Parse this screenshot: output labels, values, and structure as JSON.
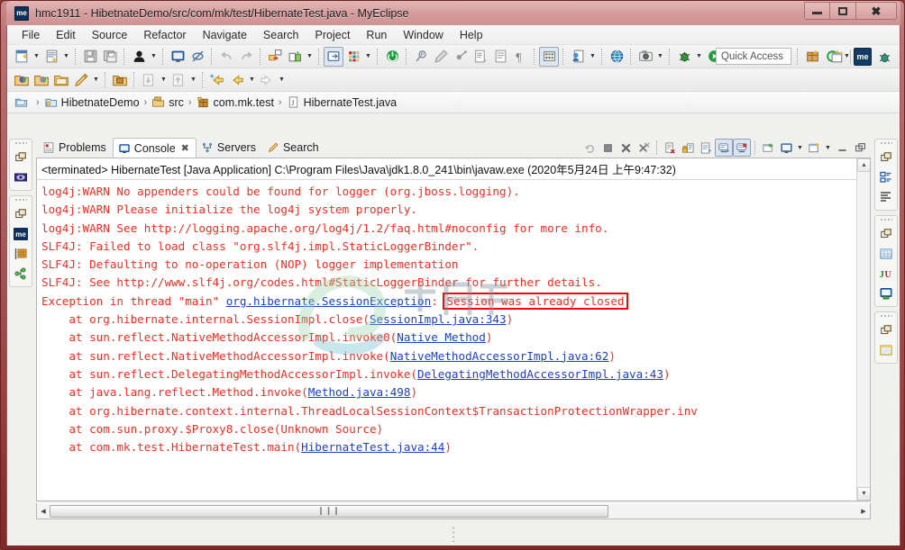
{
  "window": {
    "icon_label": "me",
    "title": "hmc1911 - HibetnateDemo/src/com/mk/test/HibernateTest.java - MyEclipse",
    "minimize_label": "Minimize",
    "maximize_label": "Maximize",
    "close_label": "Close"
  },
  "menubar": {
    "items": [
      {
        "label": "File"
      },
      {
        "label": "Edit"
      },
      {
        "label": "Source"
      },
      {
        "label": "Refactor"
      },
      {
        "label": "Navigate"
      },
      {
        "label": "Search"
      },
      {
        "label": "Project"
      },
      {
        "label": "Run"
      },
      {
        "label": "Window"
      },
      {
        "label": "Help"
      }
    ]
  },
  "toolbar": {
    "quick_access_placeholder": "Quick Access",
    "quick_access_value": "",
    "perspective_me_label": "me",
    "row1_icons": [
      "new-wizard-icon",
      "new-wizard-dropdown-icon",
      "new-java-class-icon",
      "new-java-class-dropdown-icon",
      "save-icon",
      "save-all-icon",
      "user-account-icon",
      "user-account-dropdown-icon",
      "open-console-icon",
      "toggle-breakpoint-icon",
      "undo-icon",
      "redo-icon",
      "import-icon",
      "export-icon",
      "export-dropdown-icon",
      "open-perspective-icon",
      "color-palette-icon",
      "color-palette-dropdown-icon",
      "power-icon",
      "search-tag-icon",
      "pencil-icon",
      "remote-debug-icon",
      "open-type-icon",
      "open-task-icon",
      "pilcrow-icon",
      "grid-icon",
      "new-report-icon",
      "new-report-dropdown-icon",
      "web-browser-icon",
      "snapshot-icon",
      "snapshot-dropdown-icon",
      "debug-icon",
      "debug-dropdown-icon",
      "run-icon",
      "run-dropdown-icon",
      "run-config-icon",
      "run-config-dropdown-icon",
      "run-error-icon",
      "run-error-dropdown-icon",
      "package-icon",
      "refresh-star-icon",
      "refresh-dropdown-icon"
    ],
    "row2_icons": [
      "open-resource-icon",
      "open-folder-icon",
      "open-project-icon",
      "pencil-edit-icon",
      "pencil-dropdown-icon",
      "open-package-icon",
      "previous-annotation-icon",
      "previous-annotation-dropdown-icon",
      "next-annotation-icon",
      "next-annotation-dropdown-icon",
      "back-star-icon",
      "back-icon",
      "back-dropdown-icon",
      "forward-icon",
      "forward-dropdown-icon"
    ]
  },
  "breadcrumb": {
    "items": [
      {
        "label": "",
        "icon": "workspace-icon"
      },
      {
        "label": "HibetnateDemo",
        "icon": "java-project-icon"
      },
      {
        "label": "src",
        "icon": "source-folder-icon"
      },
      {
        "label": "com.mk.test",
        "icon": "package-icon"
      },
      {
        "label": "HibernateTest.java",
        "icon": "java-file-icon"
      }
    ],
    "separator": "›"
  },
  "views": {
    "tabs": [
      {
        "label": "Problems",
        "icon": "problems-icon",
        "active": false,
        "closable": false
      },
      {
        "label": "Console",
        "icon": "console-icon",
        "active": true,
        "closable": true
      },
      {
        "label": "Servers",
        "icon": "servers-icon",
        "active": false,
        "closable": false
      },
      {
        "label": "Search",
        "icon": "search-icon",
        "active": false,
        "closable": false
      }
    ],
    "close_glyph": "✖"
  },
  "console_toolbar": {
    "buttons": [
      {
        "name": "relaunch-icon",
        "pressed": false
      },
      {
        "name": "terminate-icon",
        "pressed": false
      },
      {
        "name": "remove-launch-icon",
        "pressed": false
      },
      {
        "name": "remove-all-terminated-icon",
        "pressed": false
      },
      {
        "name": "clear-console-icon",
        "pressed": false
      },
      {
        "name": "scroll-lock-icon",
        "pressed": false
      },
      {
        "name": "word-wrap-icon",
        "pressed": false
      },
      {
        "name": "show-console-on-output-icon",
        "pressed": true
      },
      {
        "name": "show-console-on-error-icon",
        "pressed": true
      },
      {
        "name": "pin-console-icon",
        "pressed": false
      },
      {
        "name": "display-selected-console-icon",
        "pressed": false
      },
      {
        "name": "display-selected-console-dropdown-icon",
        "pressed": false
      },
      {
        "name": "open-console-icon",
        "pressed": false
      },
      {
        "name": "open-console-dropdown-icon",
        "pressed": false
      },
      {
        "name": "minimize-view-icon",
        "pressed": false
      },
      {
        "name": "maximize-view-icon",
        "pressed": false
      }
    ]
  },
  "console": {
    "launch_header": "<terminated> HibernateTest [Java Application] C:\\Program Files\\Java\\jdk1.8.0_241\\bin\\javaw.exe (2020年5月24日 上午9:47:32)",
    "highlighted_text": "Session was already closed",
    "highlight_color": "#ff0000",
    "text_color": "#ff2a20",
    "link_color": "#1d3fd0",
    "lines": [
      "log4j:WARN No appenders could be found for logger (org.jboss.logging).",
      "log4j:WARN Please initialize the log4j system properly.",
      "log4j:WARN See http://logging.apache.org/log4j/1.2/faq.html#noconfig for more info.",
      "SLF4J: Failed to load class \"org.slf4j.impl.StaticLoggerBinder\".",
      "SLF4J: Defaulting to no-operation (NOP) logger implementation",
      "SLF4J: See http://www.slf4j.org/codes.html#StaticLoggerBinder for further details.",
      "Exception in thread \"main\" org.hibernate.SessionException: Session was already closed",
      "\tat org.hibernate.internal.SessionImpl.close(SessionImpl.java:343)",
      "\tat sun.reflect.NativeMethodAccessorImpl.invoke0(Native Method)",
      "\tat sun.reflect.NativeMethodAccessorImpl.invoke(NativeMethodAccessorImpl.java:62)",
      "\tat sun.reflect.DelegatingMethodAccessorImpl.invoke(DelegatingMethodAccessorImpl.java:43)",
      "\tat java.lang.reflect.Method.invoke(Method.java:498)",
      "\tat org.hibernate.context.internal.ThreadLocalSessionContext$TransactionProtectionWrapper.inv",
      "\tat com.sun.proxy.$Proxy8.close(Unknown Source)",
      "\tat com.mk.test.HibernateTest.main(HibernateTest.java:44)"
    ],
    "segments": [
      [
        {
          "t": "log4j:WARN No appenders could be found for logger (org.jboss.logging).",
          "k": "p"
        }
      ],
      [
        {
          "t": "log4j:WARN Please initialize the log4j system properly.",
          "k": "p"
        }
      ],
      [
        {
          "t": "log4j:WARN See http://logging.apache.org/log4j/1.2/faq.html#noconfig for more info.",
          "k": "p"
        }
      ],
      [
        {
          "t": "SLF4J: Failed to load class \"org.slf4j.impl.StaticLoggerBinder\".",
          "k": "p"
        }
      ],
      [
        {
          "t": "SLF4J: Defaulting to no-operation (NOP) logger implementation",
          "k": "p"
        }
      ],
      [
        {
          "t": "SLF4J: See http://www.slf4j.org/codes.html#StaticLoggerBinder for further details.",
          "k": "p"
        }
      ],
      [
        {
          "t": "Exception in thread \"main\" ",
          "k": "p"
        },
        {
          "t": "org.hibernate.SessionException",
          "k": "l"
        },
        {
          "t": ": ",
          "k": "p"
        },
        {
          "t": "Session was already closed",
          "k": "hl"
        }
      ],
      [
        {
          "t": "    at org.hibernate.internal.SessionImpl.close(",
          "k": "p"
        },
        {
          "t": "SessionImpl.java:343",
          "k": "l"
        },
        {
          "t": ")",
          "k": "p"
        }
      ],
      [
        {
          "t": "    at sun.reflect.NativeMethodAccessorImpl.invoke0(",
          "k": "p"
        },
        {
          "t": "Native Method",
          "k": "l"
        },
        {
          "t": ")",
          "k": "p"
        }
      ],
      [
        {
          "t": "    at sun.reflect.NativeMethodAccessorImpl.invoke(",
          "k": "p"
        },
        {
          "t": "NativeMethodAccessorImpl.java:62",
          "k": "l"
        },
        {
          "t": ")",
          "k": "p"
        }
      ],
      [
        {
          "t": "    at sun.reflect.DelegatingMethodAccessorImpl.invoke(",
          "k": "p"
        },
        {
          "t": "DelegatingMethodAccessorImpl.java:43",
          "k": "l"
        },
        {
          "t": ")",
          "k": "p"
        }
      ],
      [
        {
          "t": "    at java.lang.reflect.Method.invoke(",
          "k": "p"
        },
        {
          "t": "Method.java:498",
          "k": "l"
        },
        {
          "t": ")",
          "k": "p"
        }
      ],
      [
        {
          "t": "    at org.hibernate.context.internal.ThreadLocalSessionContext$TransactionProtectionWrapper.inv",
          "k": "p"
        }
      ],
      [
        {
          "t": "    at com.sun.proxy.$Proxy8.close(Unknown Source)",
          "k": "p"
        }
      ],
      [
        {
          "t": "    at com.mk.test.HibernateTest.main(",
          "k": "p"
        },
        {
          "t": "HibernateTest.java:44",
          "k": "l"
        },
        {
          "t": ")",
          "k": "p"
        }
      ]
    ]
  },
  "scrollbars": {
    "up_arrow": "▲",
    "down_arrow": "▼",
    "left_arrow": "◀",
    "right_arrow": "▶",
    "thumb_grip": "❙❙❙"
  },
  "fastview_left": {
    "groups": [
      {
        "icons": [
          "restore-icon",
          "explorer-icon"
        ]
      },
      {
        "icons": [
          "restore-icon",
          "myeclipse-icon",
          "database-icon",
          "hierarchy-icon"
        ]
      }
    ]
  },
  "fastview_right": {
    "groups": [
      {
        "icons": [
          "restore-icon",
          "outline-icon",
          "task-list-icon"
        ]
      },
      {
        "icons": [
          "restore-icon",
          "table-icon",
          "junit-icon",
          "console-green-icon"
        ]
      },
      {
        "icons": [
          "restore-icon",
          "window-icon"
        ]
      }
    ]
  }
}
